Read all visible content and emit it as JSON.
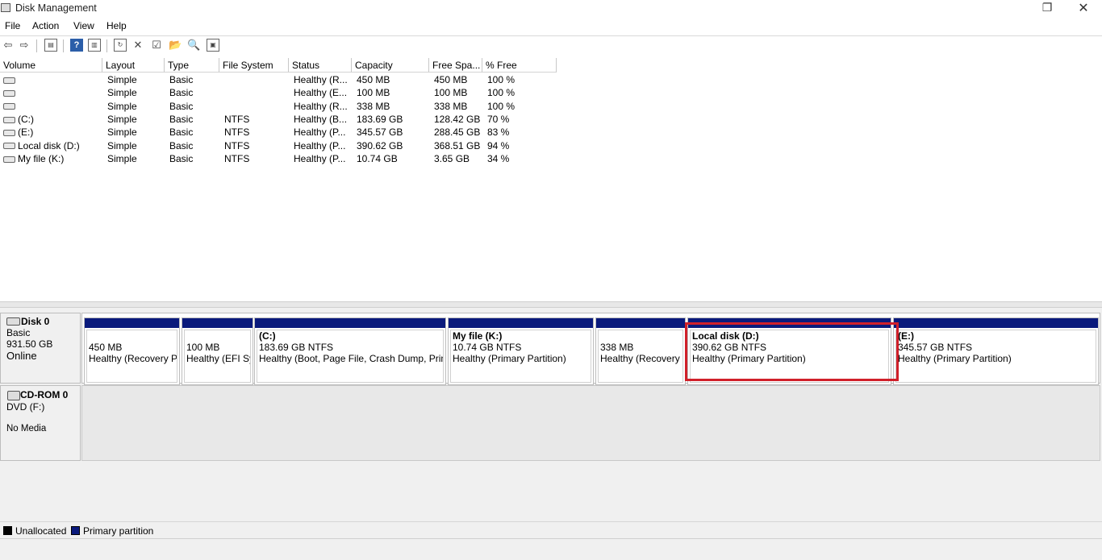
{
  "window": {
    "title": "Disk Management",
    "restore_glyph": "❐",
    "close_glyph": "✕"
  },
  "menu": [
    "File",
    "Action",
    "View",
    "Help"
  ],
  "toolbar": {
    "icons": [
      "back-arrow-icon",
      "forward-arrow-icon",
      "console-tree-icon",
      "help-icon",
      "properties-pane-icon",
      "refresh-icon",
      "delete-icon",
      "properties-icon",
      "open-folder-icon",
      "search-icon",
      "export-icon"
    ]
  },
  "volume_table": {
    "columns": [
      "Volume",
      "Layout",
      "Type",
      "File System",
      "Status",
      "Capacity",
      "Free Spa...",
      "% Free"
    ],
    "rows": [
      [
        "",
        "Simple",
        "Basic",
        "",
        "Healthy (R...",
        "450 MB",
        "450 MB",
        "100 %"
      ],
      [
        "",
        "Simple",
        "Basic",
        "",
        "Healthy (E...",
        "100 MB",
        "100 MB",
        "100 %"
      ],
      [
        "",
        "Simple",
        "Basic",
        "",
        "Healthy (R...",
        "338 MB",
        "338 MB",
        "100 %"
      ],
      [
        "(C:)",
        "Simple",
        "Basic",
        "NTFS",
        "Healthy (B...",
        "183.69 GB",
        "128.42 GB",
        "70 %"
      ],
      [
        "(E:)",
        "Simple",
        "Basic",
        "NTFS",
        "Healthy (P...",
        "345.57 GB",
        "288.45 GB",
        "83 %"
      ],
      [
        "Local disk (D:)",
        "Simple",
        "Basic",
        "NTFS",
        "Healthy (P...",
        "390.62 GB",
        "368.51 GB",
        "94 %"
      ],
      [
        "My file (K:)",
        "Simple",
        "Basic",
        "NTFS",
        "Healthy (P...",
        "10.74 GB",
        "3.65 GB",
        "34 %"
      ]
    ]
  },
  "disk0": {
    "name": "Disk 0",
    "type": "Basic",
    "size": "931.50 GB",
    "state": "Online",
    "partitions": [
      {
        "title": "",
        "size": "450 MB",
        "status": "Healthy (Recovery Partition)"
      },
      {
        "title": "",
        "size": "100 MB",
        "status": "Healthy (EFI System Partition)"
      },
      {
        "title": "(C:)",
        "size": "183.69 GB NTFS",
        "status": "Healthy (Boot, Page File, Crash Dump, Primary Partition)"
      },
      {
        "title": "My file  (K:)",
        "size": "10.74 GB NTFS",
        "status": "Healthy (Primary Partition)"
      },
      {
        "title": "",
        "size": "338 MB",
        "status": "Healthy (Recovery Partition)"
      },
      {
        "title": "Local disk  (D:)",
        "size": "390.62 GB NTFS",
        "status": "Healthy (Primary Partition)"
      },
      {
        "title": "(E:)",
        "size": "345.57 GB NTFS",
        "status": "Healthy (Primary Partition)"
      }
    ]
  },
  "cdrom0": {
    "name": "CD-ROM 0",
    "drive": "DVD (F:)",
    "media": "No Media"
  },
  "legend": [
    {
      "label": "Unallocated",
      "color": "#000000"
    },
    {
      "label": "Primary partition",
      "color": "#0a1a7c"
    }
  ]
}
